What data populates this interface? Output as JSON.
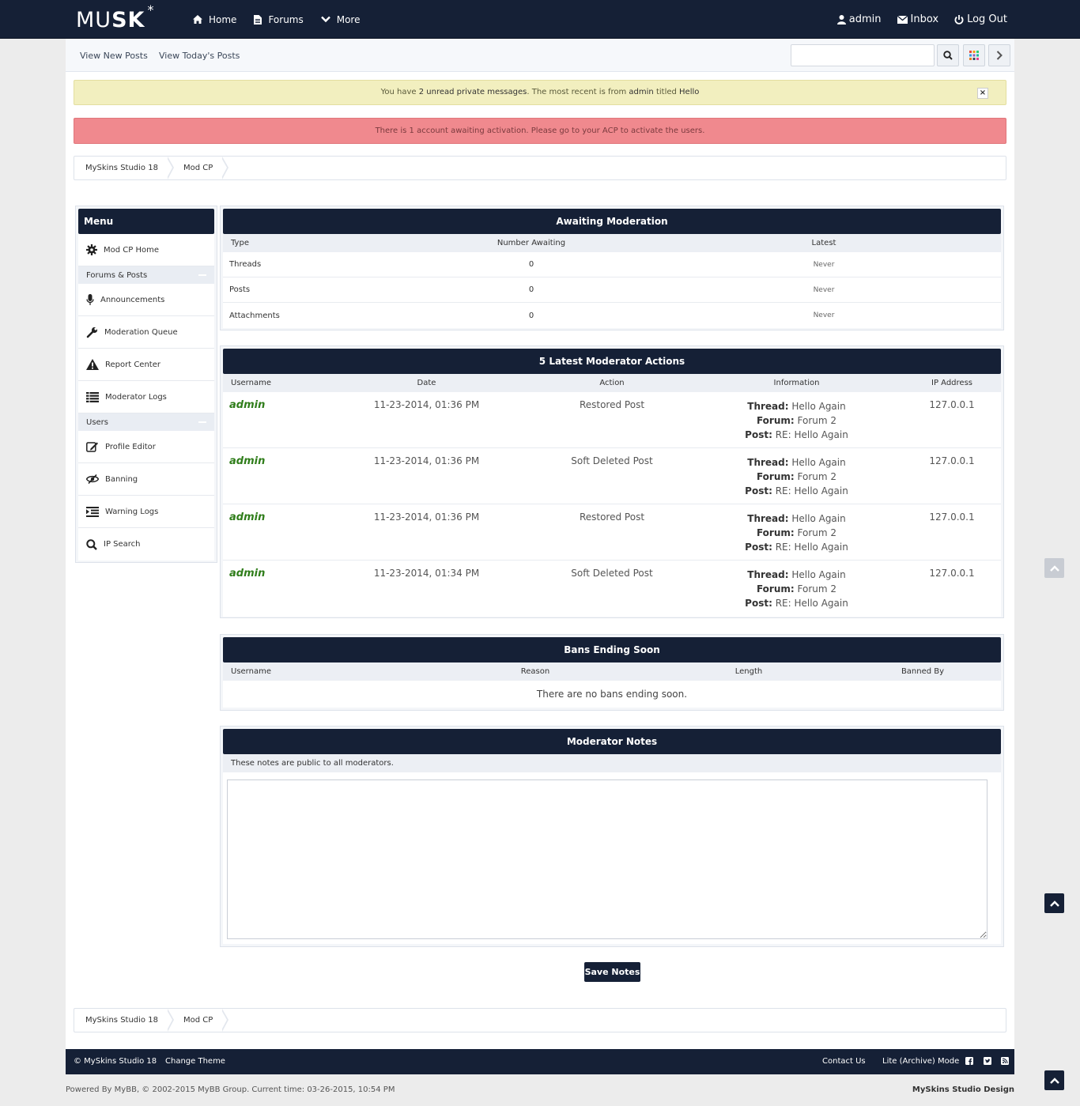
{
  "header": {
    "logo_left": "MU",
    "logo_right": "SK",
    "logo_star": "*",
    "nav": [
      {
        "label": "Home",
        "icon": "home-icon"
      },
      {
        "label": "Forums",
        "icon": "document-icon"
      },
      {
        "label": "More",
        "icon": "chevron-down-icon"
      }
    ],
    "user": {
      "username": "admin",
      "inbox": "Inbox",
      "logout": "Log Out"
    }
  },
  "subnav": {
    "new_posts": "View New Posts",
    "today_posts": "View Today's Posts",
    "search_placeholder": ""
  },
  "alerts": {
    "pm_pre": "You have ",
    "pm_count": "2 unread private messages",
    "pm_mid": ". The most recent is from ",
    "pm_from": "admin",
    "pm_titled": " titled ",
    "pm_title": "Hello",
    "close": "×",
    "activation": "There is 1 account awaiting activation. Please go to your ACP to activate the users."
  },
  "breadcrumb": [
    "MySkins Studio 18",
    "Mod CP"
  ],
  "menu": {
    "title": "Menu",
    "home": "Mod CP Home",
    "section_forums": "Forums & Posts",
    "forums_items": [
      "Announcements",
      "Moderation Queue",
      "Report Center",
      "Moderator Logs"
    ],
    "section_users": "Users",
    "users_items": [
      "Profile Editor",
      "Banning",
      "Warning Logs",
      "IP Search"
    ]
  },
  "awaiting": {
    "title": "Awaiting Moderation",
    "headers": [
      "Type",
      "Number Awaiting",
      "Latest"
    ],
    "rows": [
      {
        "type": "Threads",
        "count": "0",
        "latest": "Never"
      },
      {
        "type": "Posts",
        "count": "0",
        "latest": "Never"
      },
      {
        "type": "Attachments",
        "count": "0",
        "latest": "Never"
      }
    ]
  },
  "mod_actions": {
    "title": "5 Latest Moderator Actions",
    "headers": [
      "Username",
      "Date",
      "Action",
      "Information",
      "IP Address"
    ],
    "labels": {
      "thread": "Thread:",
      "forum": "Forum:",
      "post": "Post:"
    },
    "rows": [
      {
        "user": "admin",
        "date": "11-23-2014, 01:36 PM",
        "action": "Restored Post",
        "thread": "Hello Again",
        "forum": "Forum 2",
        "post": "RE: Hello Again",
        "ip": "127.0.0.1"
      },
      {
        "user": "admin",
        "date": "11-23-2014, 01:36 PM",
        "action": "Soft Deleted Post",
        "thread": "Hello Again",
        "forum": "Forum 2",
        "post": "RE: Hello Again",
        "ip": "127.0.0.1"
      },
      {
        "user": "admin",
        "date": "11-23-2014, 01:36 PM",
        "action": "Restored Post",
        "thread": "Hello Again",
        "forum": "Forum 2",
        "post": "RE: Hello Again",
        "ip": "127.0.0.1"
      },
      {
        "user": "admin",
        "date": "11-23-2014, 01:34 PM",
        "action": "Soft Deleted Post",
        "thread": "Hello Again",
        "forum": "Forum 2",
        "post": "RE: Hello Again",
        "ip": "127.0.0.1"
      }
    ]
  },
  "bans": {
    "title": "Bans Ending Soon",
    "headers": [
      "Username",
      "Reason",
      "Length",
      "Banned By"
    ],
    "empty": "There are no bans ending soon."
  },
  "notes": {
    "title": "Moderator Notes",
    "subtitle": "These notes are public to all moderators.",
    "value": "",
    "save": "Save Notes"
  },
  "footer": {
    "copyright": "© MySkins Studio 18",
    "change_theme": "Change Theme",
    "contact": "Contact Us",
    "lite": "Lite (Archive) Mode",
    "powered_pre": "Powered By ",
    "powered_mybb": "MyBB",
    "powered_post": ", © 2002-2015 ",
    "powered_group": "MyBB Group",
    "current_time_label": ". Current time: ",
    "current_time": "03-26-2015, 10:54 PM",
    "designer": "MySkins Studio Design"
  },
  "colors": {
    "navy": "#152036",
    "alert_yellow": "#f2efbf",
    "alert_red": "#f0898e",
    "username_green": "#2f7d1a"
  }
}
